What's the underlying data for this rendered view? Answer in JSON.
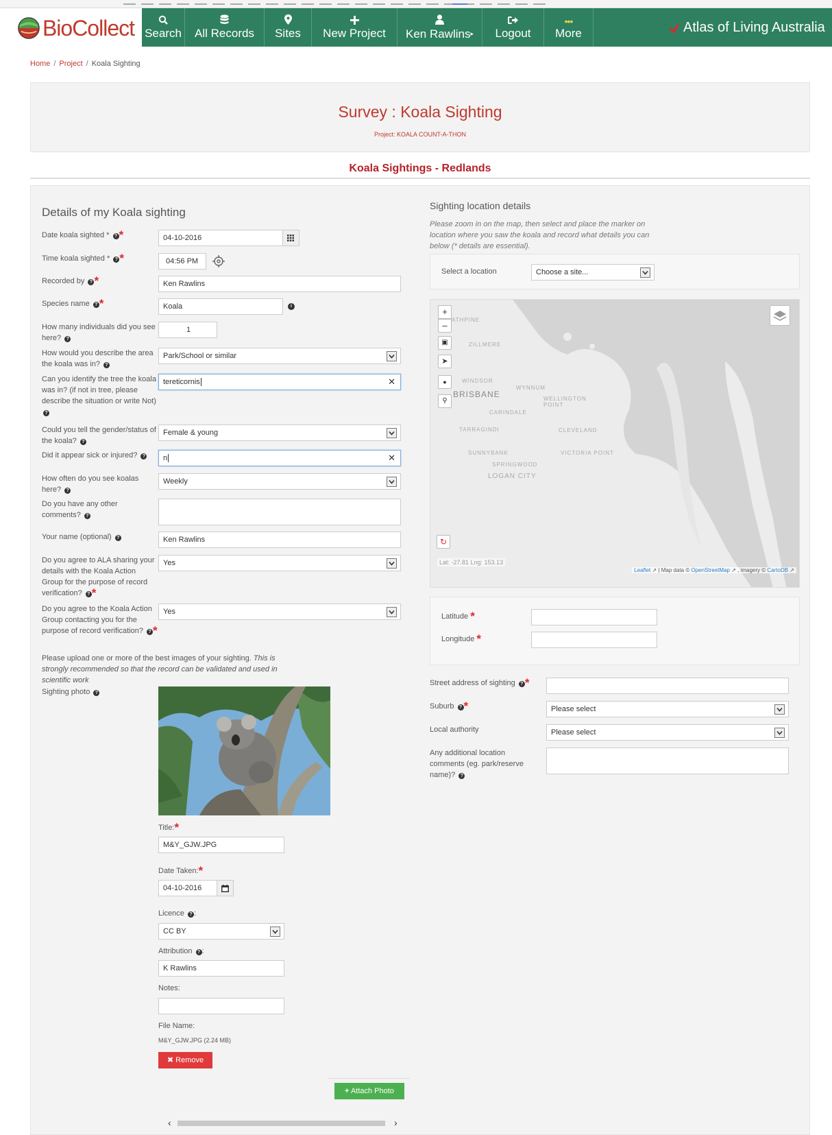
{
  "brand": {
    "logo_text": "BioCollect",
    "ala_text": "Atlas of Living Australia"
  },
  "nav": {
    "items": [
      {
        "label": "Search"
      },
      {
        "label": "All Records"
      },
      {
        "label": "Sites"
      },
      {
        "label": "New Project"
      },
      {
        "label": "Ken Rawlins"
      },
      {
        "label": "Logout"
      },
      {
        "label": "More"
      }
    ]
  },
  "breadcrumb": {
    "home": "Home",
    "project": "Project",
    "current": "Koala Sighting"
  },
  "survey": {
    "title": "Survey : Koala Sighting",
    "project_line": "Project: KOALA COUNT-A-THON"
  },
  "form_title": "Koala Sightings - Redlands",
  "left": {
    "heading": "Details of my Koala sighting",
    "fields": {
      "date_label": "Date koala sighted *",
      "date_value": "04-10-2016",
      "time_label": "Time koala sighted *",
      "time_value": "04:56 PM",
      "recorded_label": "Recorded by",
      "recorded_value": "Ken Rawlins",
      "species_label": "Species name",
      "species_value": "Koala",
      "individuals_label": "How many individuals did you see here?",
      "individuals_value": "1",
      "area_label": "How would you describe the area the koala was in?",
      "area_value": "Park/School or similar",
      "tree_label": "Can you identify the tree the koala was in? (if not in tree, please describe the situation or write Not)",
      "tree_value": "tereticornis",
      "gender_label": "Could you tell the gender/status of the koala?",
      "gender_value": "Female & young",
      "sick_label": "Did it appear sick or injured?",
      "sick_value": "n",
      "often_label": "How often do you see koalas here?",
      "often_value": "Weekly",
      "comments_label": "Do you have any other comments?",
      "comments_value": "",
      "name_label": "Your name (optional)",
      "name_value": "Ken Rawlins",
      "share_label": "Do you agree to ALA sharing your details with the Koala Action Group for the purpose of record verification?",
      "share_value": "Yes",
      "contact_label": "Do you agree to the Koala Action Group contacting you for the purpose of record verification?",
      "contact_value": "Yes"
    },
    "upload_text": "Please upload one or more of the best images of your sighting.",
    "upload_note": "This is strongly recommended so that the record can be validated and used in scientific work",
    "photo_label": "Sighting photo",
    "photo": {
      "title_label": "Title:",
      "title_value": "M&Y_GJW.JPG",
      "date_label": "Date Taken:",
      "date_value": "04-10-2016",
      "licence_label": "Licence",
      "licence_value": "CC BY",
      "attribution_label": "Attribution",
      "attribution_value": "K Rawlins",
      "notes_label": "Notes:",
      "notes_value": "",
      "filename_label": "File Name:",
      "filename_value": "M&Y_GJW.JPG (2.24 MB)",
      "remove_label": "Remove",
      "attach_label": "Attach Photo"
    }
  },
  "right": {
    "heading": "Sighting location details",
    "instructions": "Please zoom in on the map, then select and place the marker on location where you saw the koala and record what details you can below (* details are essential).",
    "select_label": "Select a location",
    "select_value": "Choose a site...",
    "map": {
      "places": [
        "ATHPINE",
        "ZILLMERE",
        "WINDSOR",
        "WYNNUM",
        "BRISBANE",
        "WELLINGTON POINT",
        "CARINDALE",
        "TARRAGINDI",
        "CLEVELAND",
        "SUNNYBANK",
        "VICTORIA POINT",
        "SPRINGWOOD",
        "LOGAN CITY"
      ],
      "coords": "Lat: -27.81 Lng: 153.13",
      "attrib_leaflet": "Leaflet",
      "attrib_mapdata": "| Map data ©",
      "attrib_osm": "OpenStreetMap",
      "attrib_imagery": ", imagery ©",
      "attrib_carto": "CartoDB"
    },
    "latitude_label": "Latitude",
    "latitude_value": "",
    "longitude_label": "Longitude",
    "longitude_value": "",
    "street_label": "Street address of sighting",
    "street_value": "",
    "suburb_label": "Suburb",
    "suburb_value": "Please select",
    "authority_label": "Local authority",
    "authority_value": "Please select",
    "additional_label": "Any additional location comments (eg. park/reserve name)?",
    "additional_value": ""
  },
  "colors": {
    "nav_green": "#2e8060",
    "accent_red": "#c0392b",
    "required_red": "#e0262b",
    "remove_red": "#e03a3a",
    "attach_green": "#4cb050"
  }
}
